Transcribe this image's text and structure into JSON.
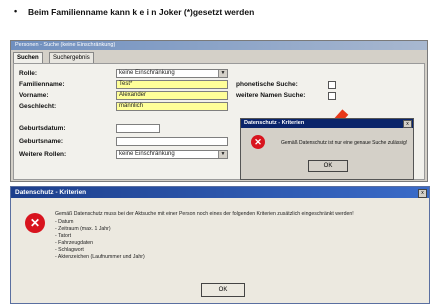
{
  "header": {
    "bullet": "•",
    "text": "Beim Familienname kann  k e i n  Joker (*)gesetzt werden"
  },
  "search_window": {
    "title": "Personen - Suche (keine Einschränkung)",
    "tabs": [
      "Suchen",
      "Suchergebnis"
    ],
    "fields": {
      "rolle": {
        "label": "Rolle:",
        "value": "keine Einschränkung"
      },
      "familienname": {
        "label": "Familienname:",
        "value": "Test*"
      },
      "vorname": {
        "label": "Vorname:",
        "value": "Alexander"
      },
      "geschlecht": {
        "label": "Geschlecht:",
        "value": "männlich"
      },
      "geburtsdatum": {
        "label": "Geburtsdatum:",
        "value": ""
      },
      "geburtsname": {
        "label": "Geburtsname:",
        "value": ""
      },
      "weitere_rollen": {
        "label": "Weitere Rollen:",
        "value": "keine Einschränkung"
      }
    },
    "options": {
      "phonetische": "phonetische Suche:",
      "weitere_namen": "weitere Namen Suche:"
    }
  },
  "small_dialog": {
    "title": "Datenschutz - Kriterien",
    "close": "x",
    "message": "Gemäß Datenschutz ist nur eine genaue Suche zulässig!",
    "ok": "OK"
  },
  "large_dialog": {
    "title": "Datenschutz - Kriterien",
    "close": "x",
    "message": "Gemäß Datenschutz muss bei der Aktsuche mit einer Person noch eines der folgenden Kriterien zusätzlich eingeschränkt werden!",
    "criteria": [
      "- Datum",
      "- Zeitraum (max. 1 Jahr)",
      "- Tatort",
      "- Fahrzeugdaten",
      "- Schlagwort",
      "- Aktenzeichen (Laufnummer und Jahr)"
    ],
    "ok": "OK"
  },
  "colors": {
    "highlight": "#ffff99",
    "title_bar": "#0a246a",
    "error": "#d8141e",
    "arrow": "#e8391a"
  }
}
